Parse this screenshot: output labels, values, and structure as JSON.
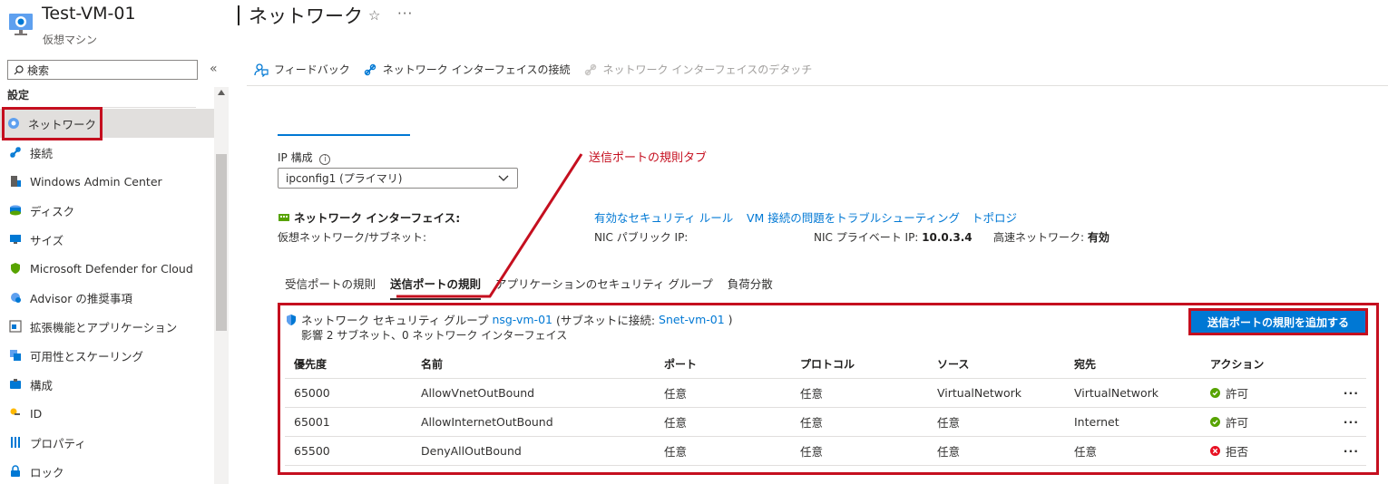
{
  "header": {
    "vm_name": "Test-VM-01",
    "vm_type": "仮想マシン",
    "page_title": "ネットワーク",
    "favorite_icon": "star-icon",
    "more_label": "···"
  },
  "sidebar": {
    "search_placeholder": "検索",
    "collapse_label": "«",
    "section": "設定",
    "items": [
      {
        "label": "ネットワーク",
        "icon": "network-icon"
      },
      {
        "label": "接続",
        "icon": "connect-icon"
      },
      {
        "label": "Windows Admin Center",
        "icon": "admin-center-icon"
      },
      {
        "label": "ディスク",
        "icon": "disk-icon"
      },
      {
        "label": "サイズ",
        "icon": "size-icon"
      },
      {
        "label": "Microsoft Defender for Cloud",
        "icon": "defender-icon"
      },
      {
        "label": "Advisor の推奨事項",
        "icon": "advisor-icon"
      },
      {
        "label": "拡張機能とアプリケーション",
        "icon": "extensions-icon"
      },
      {
        "label": "可用性とスケーリング",
        "icon": "availability-icon"
      },
      {
        "label": "構成",
        "icon": "configuration-icon"
      },
      {
        "label": "ID",
        "icon": "identity-icon"
      },
      {
        "label": "プロパティ",
        "icon": "properties-icon"
      },
      {
        "label": "ロック",
        "icon": "lock-icon"
      }
    ]
  },
  "toolbar": {
    "feedback": "フィードバック",
    "attach": "ネットワーク インターフェイスの接続",
    "detach": "ネットワーク インターフェイスのデタッチ"
  },
  "ip_config": {
    "label": "IP 構成",
    "info_icon": "info-icon",
    "selected": "ipconfig1 (プライマリ)"
  },
  "nic": {
    "label": "ネットワーク インターフェイス:",
    "link_effective_rules": "有効なセキュリティ ルール",
    "link_troubleshoot": "VM 接続の問題をトラブルシューティング",
    "link_topology": "トポロジ",
    "vnet_label": "仮想ネットワーク/サブネット:",
    "public_ip_label": "NIC パブリック IP:",
    "private_ip_label": "NIC プライベート IP:",
    "private_ip_value": "10.0.3.4",
    "accel_label": "高速ネットワーク:",
    "accel_value": "有効"
  },
  "tabs": [
    {
      "label": "受信ポートの規則"
    },
    {
      "label": "送信ポートの規則"
    },
    {
      "label": "アプリケーションのセキュリティ グループ"
    },
    {
      "label": "負荷分散"
    }
  ],
  "annotation": "送信ポートの規則タブ",
  "nsg": {
    "prefix": "ネットワーク セキュリティ グループ",
    "name": "nsg-vm-01",
    "attached_prefix": "(サブネットに接続:",
    "subnet": "Snet-vm-01",
    "attached_suffix": ")",
    "impact": "影響 2 サブネット、0 ネットワーク インターフェイス",
    "add_button": "送信ポートの規則を追加する"
  },
  "rules_table": {
    "headers": [
      "優先度",
      "名前",
      "ポート",
      "プロトコル",
      "ソース",
      "宛先",
      "アクション"
    ],
    "rows": [
      {
        "priority": "65000",
        "name": "AllowVnetOutBound",
        "port": "任意",
        "protocol": "任意",
        "source": "VirtualNetwork",
        "dest": "VirtualNetwork",
        "action": "許可",
        "action_type": "allow"
      },
      {
        "priority": "65001",
        "name": "AllowInternetOutBound",
        "port": "任意",
        "protocol": "任意",
        "source": "任意",
        "dest": "Internet",
        "action": "許可",
        "action_type": "allow"
      },
      {
        "priority": "65500",
        "name": "DenyAllOutBound",
        "port": "任意",
        "protocol": "任意",
        "source": "任意",
        "dest": "任意",
        "action": "拒否",
        "action_type": "deny"
      }
    ],
    "row_more": "···"
  },
  "colors": {
    "accent": "#0078d4",
    "highlight": "#c50f1f",
    "allow": "#57a300",
    "deny": "#e81123"
  }
}
